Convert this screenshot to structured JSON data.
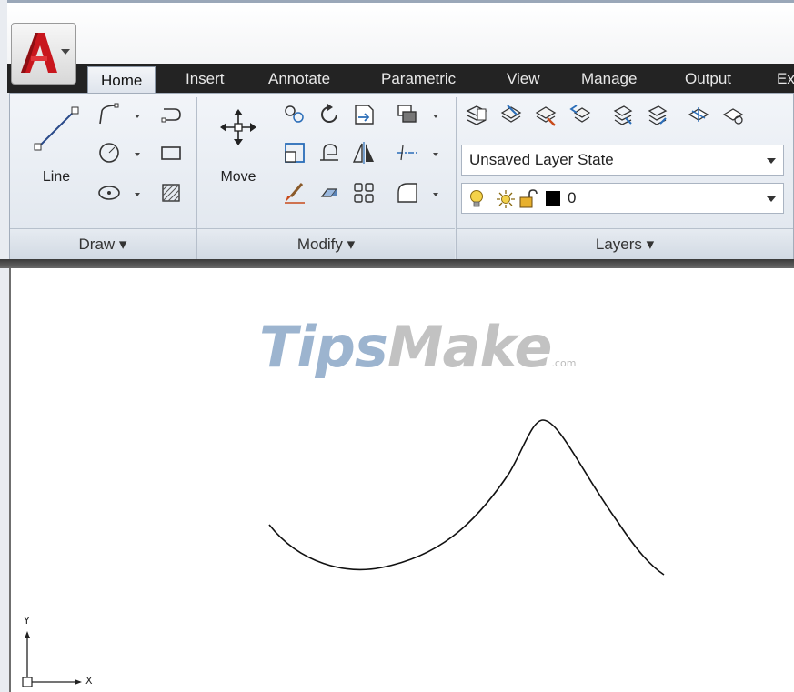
{
  "tabs": [
    "Home",
    "Insert",
    "Annotate",
    "Parametric",
    "View",
    "Manage",
    "Output",
    "Ex"
  ],
  "active_tab": "Home",
  "draw_panel": {
    "line_label": "Line",
    "title": "Draw ▾"
  },
  "modify_panel": {
    "move_label": "Move",
    "title": "Modify ▾"
  },
  "layers_panel": {
    "layer_state": "Unsaved Layer State",
    "current_layer": "0",
    "title": "Layers ▾"
  },
  "watermark": {
    "part1": "Tips",
    "part2": "Make",
    "part3": ".com"
  },
  "ucs": {
    "y_label": "Y",
    "x_label": "X"
  },
  "colors": {
    "tab_bar": "#232323",
    "ribbon": "#e3e8ef",
    "canvas": "#ffffff",
    "logo_red": "#c8161d"
  }
}
